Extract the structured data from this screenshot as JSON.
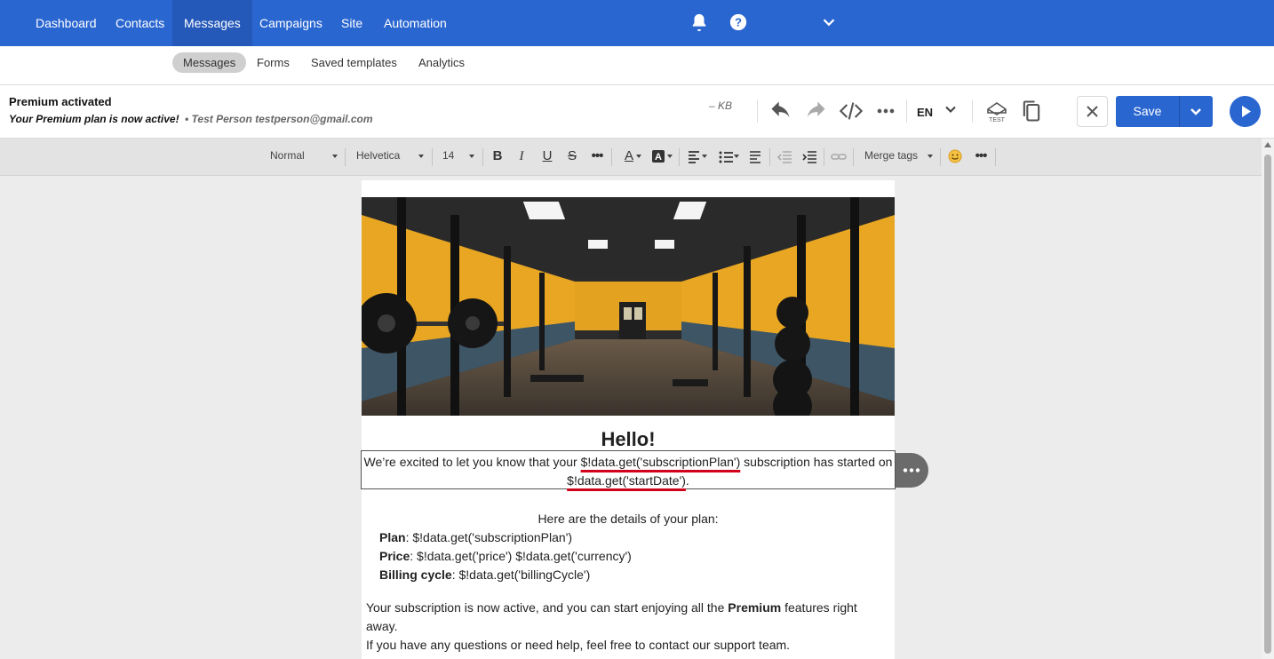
{
  "topnav": {
    "items": [
      {
        "label": "Dashboard"
      },
      {
        "label": "Contacts"
      },
      {
        "label": "Messages"
      },
      {
        "label": "Campaigns"
      },
      {
        "label": "Site"
      },
      {
        "label": "Automation"
      }
    ],
    "active": "Messages",
    "icons": [
      "bell-icon",
      "help-icon",
      "chevron-down-icon"
    ]
  },
  "subnav": {
    "items": [
      {
        "label": "Messages"
      },
      {
        "label": "Forms"
      },
      {
        "label": "Saved templates"
      },
      {
        "label": "Analytics"
      }
    ],
    "active": "Messages"
  },
  "header": {
    "message_name": "Premium activated",
    "subject": "Your Premium plan is now active!",
    "sender": "• Test Person testperson@gmail.com",
    "size": "– KB",
    "language": "EN",
    "save_label": "Save",
    "icons": [
      "undo-icon",
      "redo-icon",
      "code-icon",
      "more-icon",
      "test-email-icon",
      "copy-icon",
      "close-icon",
      "play-icon"
    ]
  },
  "toolbar": {
    "block_style": "Normal",
    "font_family": "Helvetica",
    "font_size": "14",
    "merge_tags_label": "Merge tags",
    "icons": [
      "bold-icon",
      "italic-icon",
      "underline-icon",
      "strikethrough-icon",
      "more-icon",
      "text-color-icon",
      "highlight-icon",
      "align-icon",
      "list-icon",
      "line-height-icon",
      "outdent-icon",
      "indent-icon",
      "link-icon",
      "emoji-icon",
      "more-icon"
    ]
  },
  "email": {
    "hero_alt": "gym-photo",
    "greeting": "Hello!",
    "intro_part1": "We’re excited to let you know that your ",
    "intro_tag1": "$!data.get('subscriptionPlan')",
    "intro_part2": " subscription has started on ",
    "intro_tag2": "$!data.get('startDate')",
    "intro_end": ".",
    "details_intro": "Here are the details of your plan:",
    "details": [
      {
        "label": "Plan",
        "value": ": $!data.get('subscriptionPlan')"
      },
      {
        "label": "Price",
        "value": ": $!data.get('price') $!data.get('currency')"
      },
      {
        "label": "Billing cycle",
        "value": ": $!data.get('billingCycle')"
      }
    ],
    "para2_part1": "Your subscription is now active, and you can start enjoying all the ",
    "para2_bold": "Premium",
    "para2_part2": " features right away.",
    "para3": "If you have any questions or need help, feel free to contact our support team."
  },
  "colors": {
    "brand_blue": "#2a66d0",
    "highlight_underline": "#d0021b",
    "gym_yellow": "#e8a623"
  }
}
